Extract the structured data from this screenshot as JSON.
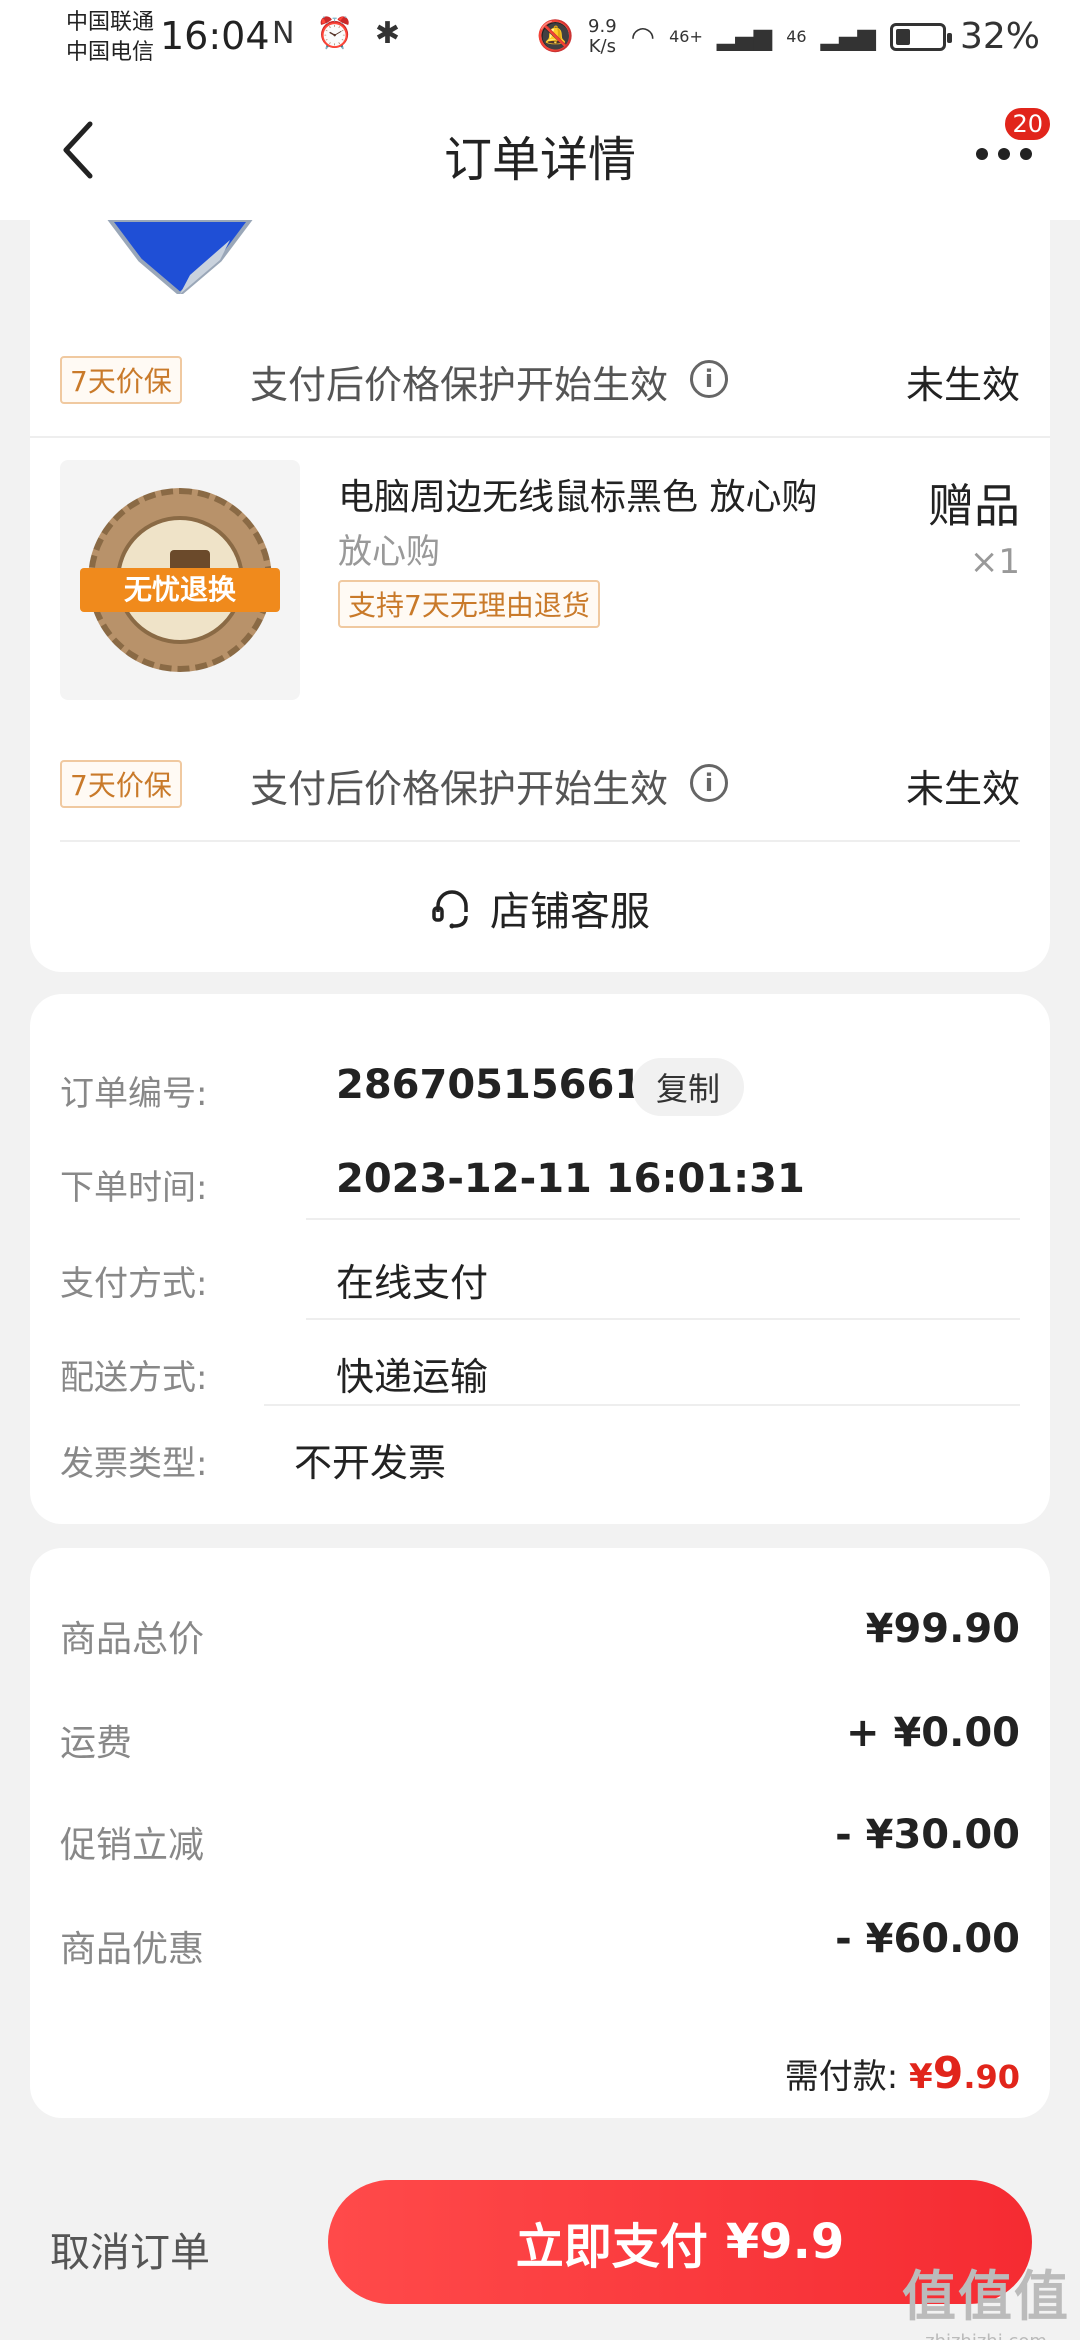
{
  "status_bar": {
    "carrier1": "中国联通",
    "carrier2": "中国电信",
    "time": "16:04",
    "icons": "N ⏰ ✱",
    "net_speed_value": "9.9",
    "net_speed_unit": "K/s",
    "signal1": "46+",
    "signal2": "46",
    "battery_level": 0.32,
    "battery_pct": "32%"
  },
  "nav": {
    "title": "订单详情",
    "badge": "20",
    "back_icon": "chevron-left-icon",
    "more_icon": "more-dots-icon"
  },
  "protect": {
    "tag": "7天价保",
    "desc": "支付后价格保护开始生效",
    "info_glyph": "i",
    "status": "未生效"
  },
  "product": {
    "name": "电脑周边无线鼠标黑色 放心购",
    "sub": "放心购",
    "tag": "支持7天无理由退货",
    "badge": "赠品",
    "qty": "×1",
    "seal_text": "无忧退换"
  },
  "service": {
    "label": "店铺客服",
    "icon": "headset-icon"
  },
  "order_info": {
    "number_label": "订单编号:",
    "number_value": "286705156613",
    "copy_label": "复制",
    "time_label": "下单时间:",
    "time_value": "2023-12-11 16:01:31",
    "payment_label": "支付方式:",
    "payment_value": "在线支付",
    "delivery_label": "配送方式:",
    "delivery_value": "快递运输",
    "invoice_label": "发票类型:",
    "invoice_value": "不开发票"
  },
  "price_info": {
    "subtotal_label": "商品总价",
    "subtotal_value": "¥99.90",
    "shipping_label": "运费",
    "shipping_value": "+ ¥0.00",
    "promo_label": "促销立减",
    "promo_value": "- ¥30.00",
    "discount_label": "商品优惠",
    "discount_value": "- ¥60.00",
    "total_label": "需付款:",
    "total_symbol": "¥",
    "total_int": "9",
    "total_dec": ".90"
  },
  "bottom": {
    "cancel_label": "取消订单",
    "pay_label": "立即支付",
    "pay_amount": "¥9.9",
    "watermark_main": "值值值",
    "watermark_sub": "zhizhizhi.com"
  },
  "colors": {
    "accent": "#e1251b",
    "pay_button": "#f52b32",
    "tag_orange": "#c97a2a"
  }
}
